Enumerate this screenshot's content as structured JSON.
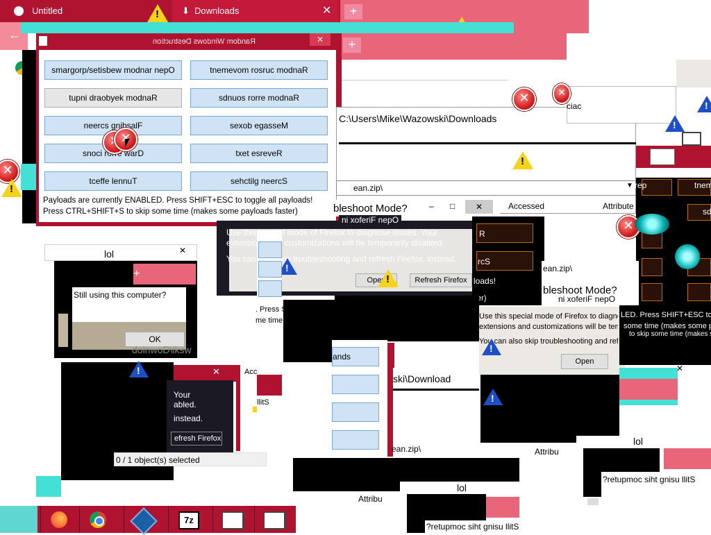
{
  "browser": {
    "tab1_title": "Untitled",
    "tab2_title": "Downloads",
    "new_tab_symbol": "+"
  },
  "main_dialog": {
    "title": "Random Windows Destruction",
    "close_label": "✕",
    "buttons": {
      "b1": "smargorp/setisbew modnar nepO",
      "b2": "tnemevom rosruc modnaR",
      "b3": "tupni draobyek modnaR",
      "b4": "sdnuos rorre modnaR",
      "b5": "neercs gnibsalF",
      "b6": "sexob egasseM",
      "b7": "snoci rorre warD",
      "b8": "txet esreveR",
      "b9": "tceffe lennuT",
      "b10": "sehctilg neercS"
    },
    "status_line1": "Payloads are currently ENABLED. Press SHIFT+ESC to toggle all payloads!",
    "status_line2": "Press CTRL+SHIFT+S to skip some time (makes some payloads faster)"
  },
  "explorer": {
    "path": "C:\\Users\\Mike\\Wazowski\\Downloads",
    "file_fragment": "ean.zip\\",
    "col_accessed": "Accessed",
    "col_attributes": "Attribute",
    "status": "0 / 1 object(s) selected",
    "stills": "llitS",
    "path_fragment": "ski\\Download",
    "attrib_fragment": "Attribu"
  },
  "troubleshoot": {
    "title": "bleshoot Mode?",
    "open_fragment": "ni xoferiF nepO",
    "line1": "Use this special mode of Firefox to diagnose issues. Your",
    "line2": "extensions and customizations will be temporarily disabled",
    "line3": "You can also skip troubleshooting and refresh Firefox, instead.",
    "open_button": "Open",
    "refresh_button": "Refresh Firefox"
  },
  "lol_dialog": {
    "title": "lol",
    "message": "Still using this computer?",
    "ok_label": "OK",
    "reversed_message": "?retupmoc siht gnisu llitS"
  },
  "fragments": {
    "ands": "ands",
    "press": ". Press S",
    "metime": "me time",
    "your": "Your",
    "abled": "abled.",
    "instead": "instead.",
    "refresh_ff": "efresh Firefox",
    "led_press": "LED. Press SHIFT+ESC to",
    "some_time": "some time (makes some pa",
    "skip_time": "to skip some time (makes som",
    "r": "R",
    "rcs": "rcS",
    "loads": "loads!",
    "ter": "ter)",
    "sd": "sd",
    "tnem": "tnem",
    "rep": "rep",
    "ciac": "ciac"
  },
  "taskbar": {
    "items": [
      "firefox-icon",
      "chrome-icon",
      "virtualbox-icon",
      "7zip-icon",
      "window-icon",
      "window-icon-2"
    ]
  },
  "colors": {
    "crimson": "#b01330",
    "pink": "#e8657a",
    "cyan": "#43e0d6",
    "dialog_button": "#cfe3f5"
  }
}
